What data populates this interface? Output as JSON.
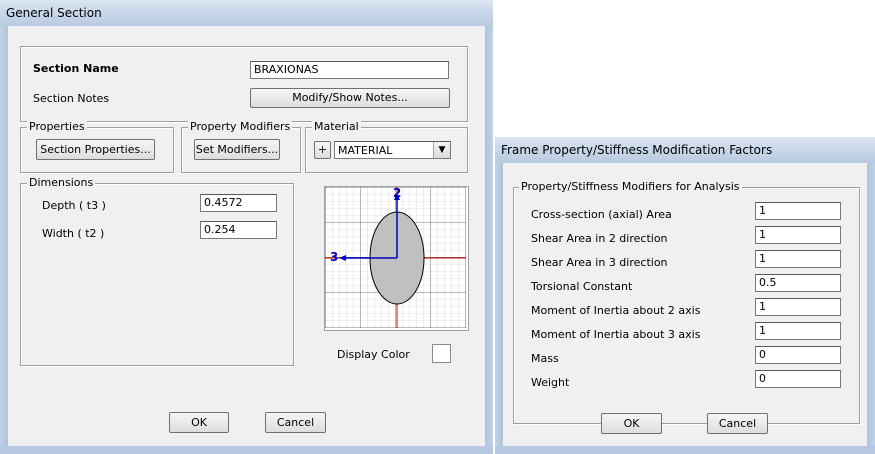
{
  "background_windows": {
    "color": "#dfe7f1"
  },
  "general_section": {
    "title": "General Section",
    "section_name_label": "Section Name",
    "section_name_value": "BRAXIONAS",
    "section_notes_label": "Section Notes",
    "modify_notes_button": "Modify/Show Notes...",
    "properties_group": "Properties",
    "section_properties_button": "Section Properties...",
    "property_modifiers_group": "Property Modifiers",
    "set_modifiers_button": "Set Modifiers...",
    "material_group": "Material",
    "material_plus": "+",
    "material_value": "MATERIAL",
    "dimensions_group": "Dimensions",
    "depth_label": "Depth  ( t3 )",
    "depth_value": "0.4572",
    "width_label": "Width  ( t2 )",
    "width_value": "0.254",
    "axis_2_label": "2",
    "axis_3_label": "3",
    "display_color_label": "Display Color",
    "display_color": "#ffffff",
    "ok_button": "OK",
    "cancel_button": "Cancel"
  },
  "modification_factors": {
    "title": "Frame Property/Stiffness Modification Factors",
    "group_label": "Property/Stiffness Modifiers for Analysis",
    "rows": [
      {
        "label": "Cross-section (axial) Area",
        "value": "1"
      },
      {
        "label": "Shear Area in 2 direction",
        "value": "1"
      },
      {
        "label": "Shear Area in 3 direction",
        "value": "1"
      },
      {
        "label": "Torsional Constant",
        "value": "0.5"
      },
      {
        "label": "Moment of Inertia about 2 axis",
        "value": "1"
      },
      {
        "label": "Moment of Inertia about 3 axis",
        "value": "1"
      },
      {
        "label": "Mass",
        "value": "0"
      },
      {
        "label": "Weight",
        "value": "0"
      }
    ],
    "ok_button": "OK",
    "cancel_button": "Cancel"
  },
  "colors": {
    "section_fill": "#c0c0c0",
    "axis_blue": "#0000c0",
    "axis_red": "#d00000",
    "grid": "#b8b8b8"
  }
}
